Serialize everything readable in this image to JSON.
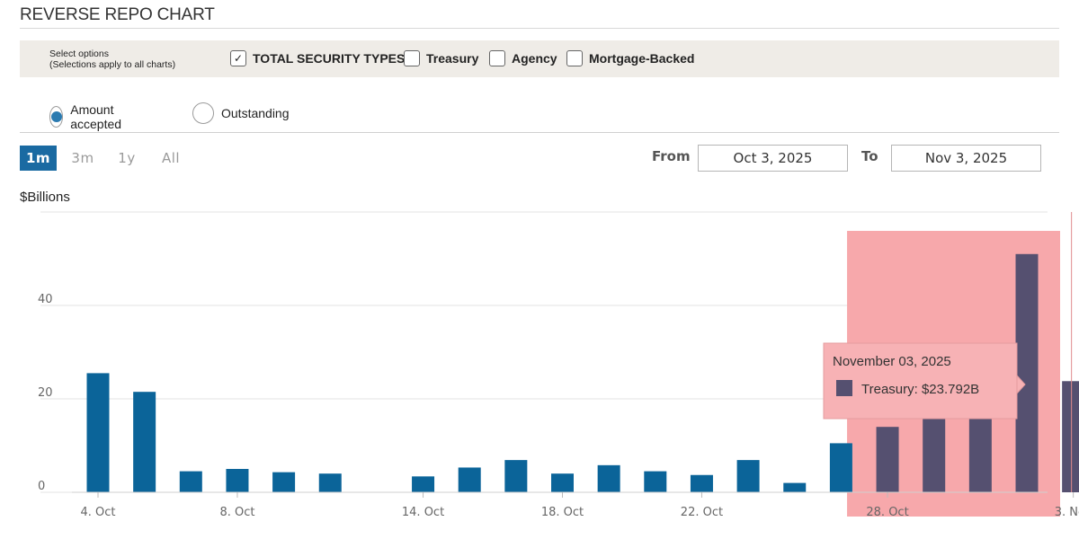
{
  "header": {
    "title": "REVERSE REPO CHART"
  },
  "options": {
    "note_line1": "Select options",
    "note_line2": "(Selections apply to all charts)",
    "checkboxes": [
      {
        "label": "TOTAL SECURITY TYPES",
        "checked": true
      },
      {
        "label": "Treasury",
        "checked": false
      },
      {
        "label": "Agency",
        "checked": false
      },
      {
        "label": "Mortgage-Backed",
        "checked": false
      }
    ],
    "check_glyph": "✓"
  },
  "measure": {
    "radios": [
      {
        "label": "Amount accepted",
        "selected": true
      },
      {
        "label": "Outstanding",
        "selected": false
      }
    ]
  },
  "range": {
    "buttons": [
      {
        "label": "1m",
        "active": true
      },
      {
        "label": "3m",
        "active": false
      },
      {
        "label": "1y",
        "active": false
      },
      {
        "label": "All",
        "active": false
      }
    ],
    "from_label": "From",
    "from_value": "Oct 3, 2025",
    "to_label": "To",
    "to_value": "Nov 3, 2025"
  },
  "chart_data": {
    "type": "bar",
    "ylabel": "$Billions",
    "ylim": [
      0,
      60
    ],
    "yticks": [
      0,
      20,
      40
    ],
    "grid": true,
    "colors": {
      "bar": "#0b6499",
      "selected_bar": "#555070",
      "selection_band": "#f7a8ab",
      "grid": "#e3e3e3"
    },
    "x_tick_labels": [
      {
        "label": "4. Oct",
        "date": "2025-10-04"
      },
      {
        "label": "8. Oct",
        "date": "2025-10-08"
      },
      {
        "label": "14. Oct",
        "date": "2025-10-14"
      },
      {
        "label": "18. Oct",
        "date": "2025-10-18"
      },
      {
        "label": "22. Oct",
        "date": "2025-10-22"
      },
      {
        "label": "28. Oct",
        "date": "2025-10-28"
      },
      {
        "label": "3. Nov",
        "date": "2025-11-03"
      }
    ],
    "bars": [
      {
        "date": "2025-10-03",
        "value": 25.5
      },
      {
        "date": "2025-10-06",
        "value": 21.5
      },
      {
        "date": "2025-10-07",
        "value": 4.5
      },
      {
        "date": "2025-10-08",
        "value": 5.0
      },
      {
        "date": "2025-10-09",
        "value": 4.3
      },
      {
        "date": "2025-10-10",
        "value": 4.0
      },
      {
        "date": "2025-10-14",
        "value": 3.4
      },
      {
        "date": "2025-10-15",
        "value": 5.3
      },
      {
        "date": "2025-10-16",
        "value": 6.9
      },
      {
        "date": "2025-10-17",
        "value": 4.0
      },
      {
        "date": "2025-10-20",
        "value": 5.8
      },
      {
        "date": "2025-10-21",
        "value": 4.5
      },
      {
        "date": "2025-10-22",
        "value": 3.7
      },
      {
        "date": "2025-10-23",
        "value": 6.9
      },
      {
        "date": "2025-10-24",
        "value": 2.0
      },
      {
        "date": "2025-10-27",
        "value": 10.5
      },
      {
        "date": "2025-10-28",
        "value": 14.0
      },
      {
        "date": "2025-10-29",
        "value": 20.0
      },
      {
        "date": "2025-10-30",
        "value": 25.0
      },
      {
        "date": "2025-10-31",
        "value": 51.0
      },
      {
        "date": "2025-11-03",
        "value": 23.792
      }
    ],
    "selection": {
      "from": "2025-10-28",
      "to": "2025-11-03"
    },
    "tooltip": {
      "title": "November 03, 2025",
      "series": "Treasury",
      "value_text": "$23.792B"
    }
  }
}
